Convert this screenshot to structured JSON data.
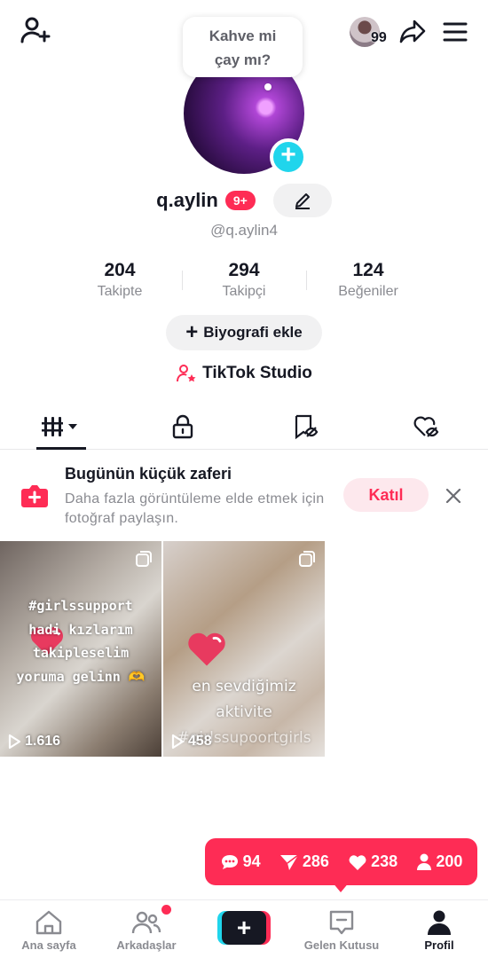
{
  "header": {
    "add_user_icon": "person-plus-icon",
    "mini_avatar_count": "99",
    "share_icon": "share-arrow-icon",
    "menu_icon": "hamburger-menu-icon"
  },
  "profile": {
    "bubble_text_line1": "Kahve mi",
    "bubble_text_line2": "çay mı?",
    "username": "q.aylin",
    "notif_badge": "9+",
    "handle": "@q.aylin4",
    "stats": [
      {
        "value": "204",
        "label": "Takipte"
      },
      {
        "value": "294",
        "label": "Takipçi"
      },
      {
        "value": "124",
        "label": "Beğeniler"
      }
    ],
    "bio_button": "Biyografi ekle",
    "studio_link": "TikTok Studio"
  },
  "tabs": [
    {
      "name": "videos-grid",
      "icon": "grid-columns-icon",
      "active": true
    },
    {
      "name": "private",
      "icon": "lock-icon",
      "active": false
    },
    {
      "name": "favorites",
      "icon": "bookmark-hidden-icon",
      "active": false
    },
    {
      "name": "liked",
      "icon": "heart-hidden-icon",
      "active": false
    }
  ],
  "banner": {
    "title": "Bugünün küçük zaferi",
    "text": "Daha fazla görüntüleme elde etmek için fotoğraf paylaşın.",
    "join_label": "Katıl"
  },
  "videos": [
    {
      "overlay_lines": [
        "#girlssupport",
        "hadi kızlarım",
        "takipleselim",
        "yoruma gelinn 🫶"
      ],
      "views": "1.616"
    },
    {
      "overlay_lines": [
        "en sevdiğimiz",
        "aktivite",
        "#girlssupoortgirls"
      ],
      "views": "458"
    }
  ],
  "activity_toast": {
    "comments": "94",
    "shares": "286",
    "likes": "238",
    "followers": "200"
  },
  "bottom_nav": [
    {
      "label": "Ana sayfa",
      "icon": "home-icon"
    },
    {
      "label": "Arkadaşlar",
      "icon": "friends-icon"
    },
    {
      "label": "",
      "icon": "plus-icon"
    },
    {
      "label": "Gelen Kutusu",
      "icon": "inbox-icon"
    },
    {
      "label": "Profil",
      "icon": "profile-icon"
    }
  ],
  "colors": {
    "accent": "#fe2c55",
    "cyan": "#20d5ec",
    "text": "#161823",
    "muted": "#8a8b91"
  }
}
